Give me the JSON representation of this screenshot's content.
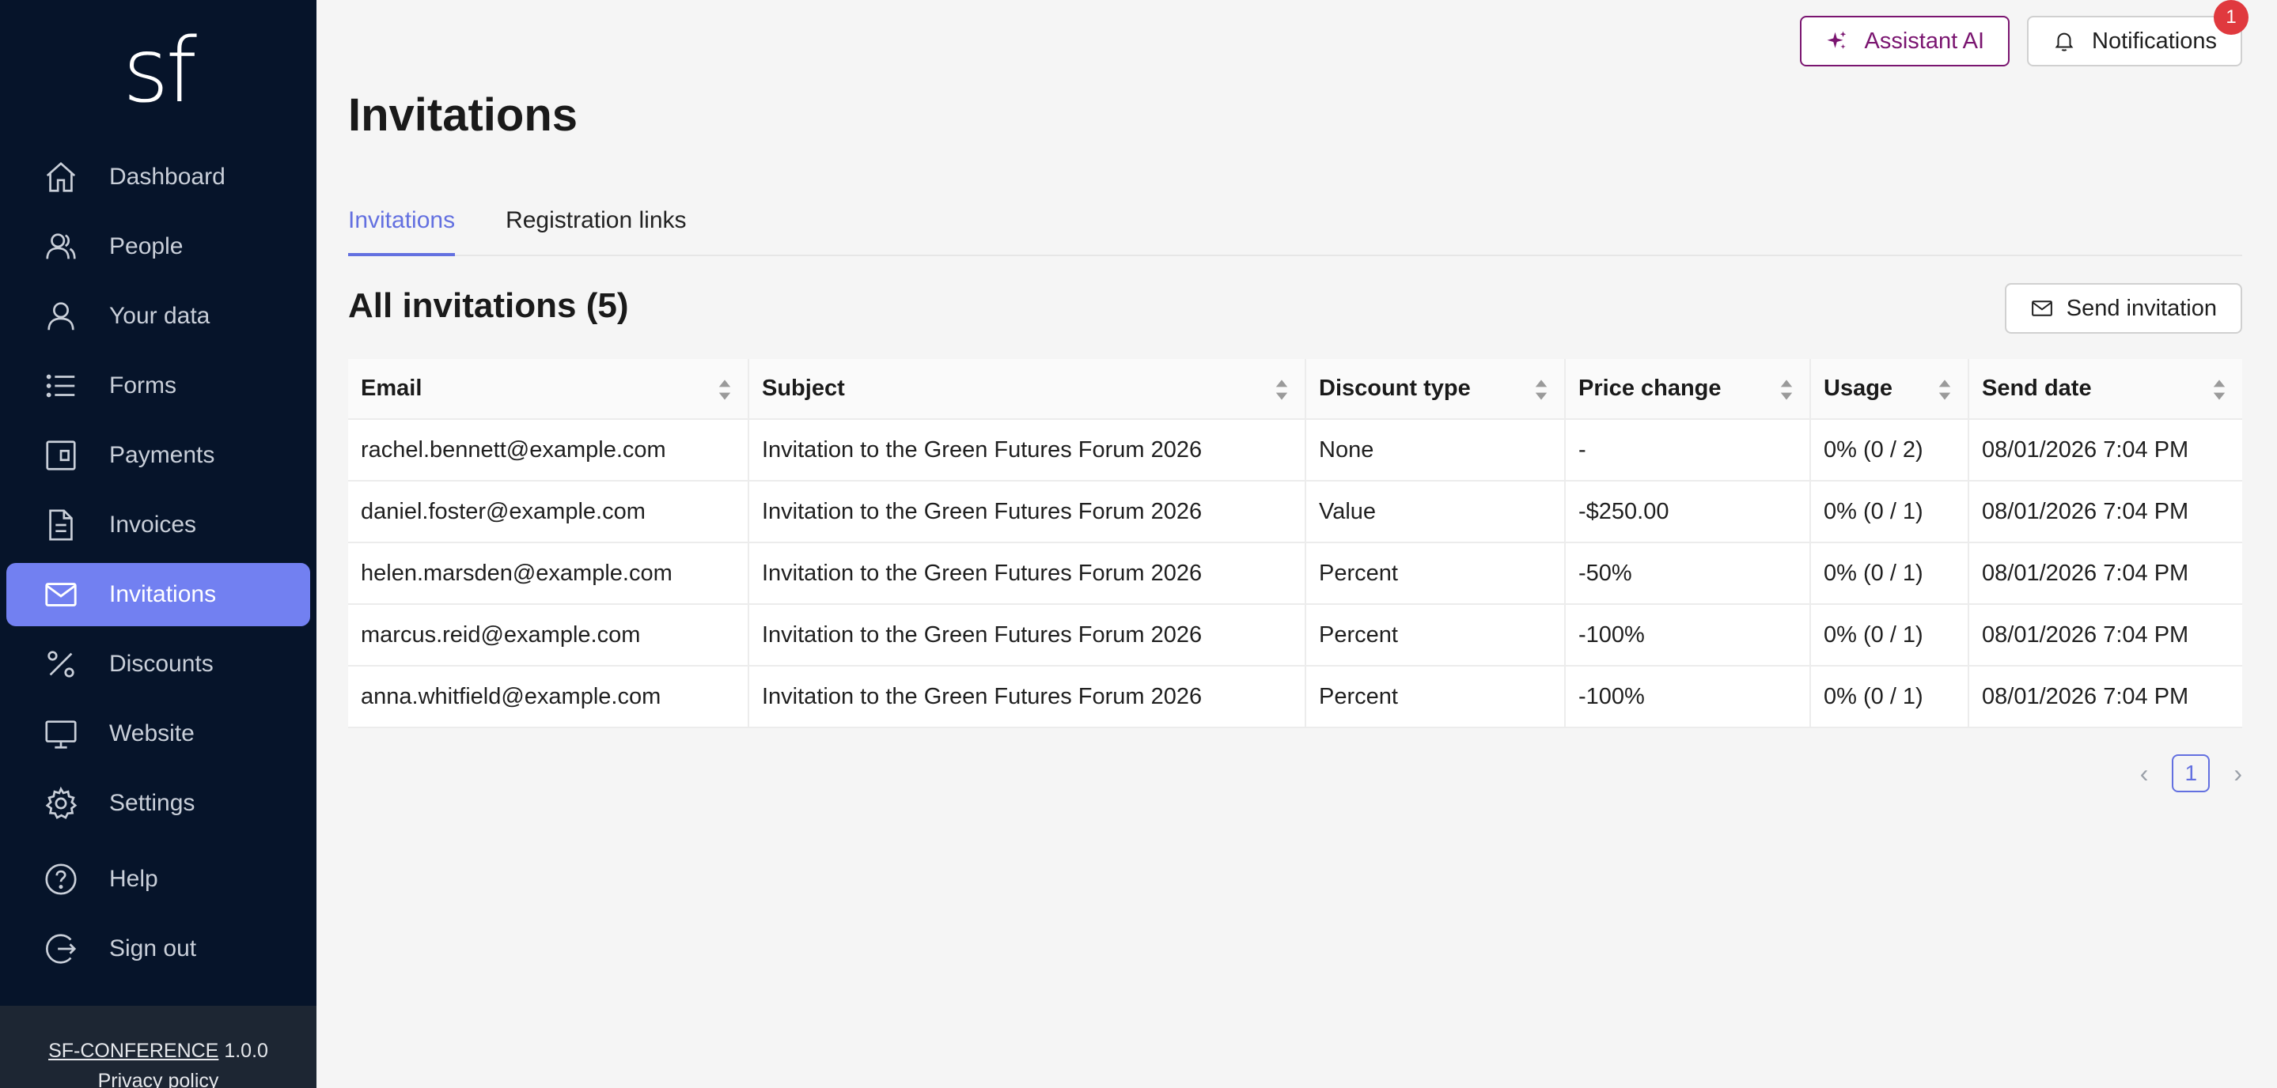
{
  "brand": {
    "logo_text": "sf"
  },
  "sidebar": {
    "items": [
      {
        "label": "Dashboard"
      },
      {
        "label": "People"
      },
      {
        "label": "Your data"
      },
      {
        "label": "Forms"
      },
      {
        "label": "Payments"
      },
      {
        "label": "Invoices"
      },
      {
        "label": "Invitations"
      },
      {
        "label": "Discounts"
      },
      {
        "label": "Website"
      },
      {
        "label": "Settings"
      },
      {
        "label": "Help"
      },
      {
        "label": "Sign out"
      }
    ],
    "footer": {
      "app_name": "SF-CONFERENCE",
      "version": "1.0.0",
      "privacy": "Privacy policy"
    }
  },
  "header": {
    "assistant_label": "Assistant AI",
    "notifications_label": "Notifications",
    "notifications_count": "1"
  },
  "page": {
    "title": "Invitations"
  },
  "tabs": [
    {
      "label": "Invitations"
    },
    {
      "label": "Registration links"
    }
  ],
  "section": {
    "title": "All invitations (5)",
    "send_label": "Send invitation"
  },
  "table": {
    "columns": [
      "Email",
      "Subject",
      "Discount type",
      "Price change",
      "Usage",
      "Send date"
    ],
    "rows": [
      [
        "rachel.bennett@example.com",
        "Invitation to the Green Futures Forum 2026",
        "None",
        "-",
        "0% (0 / 2)",
        "08/01/2026 7:04 PM"
      ],
      [
        "daniel.foster@example.com",
        "Invitation to the Green Futures Forum 2026",
        "Value",
        "-$250.00",
        "0% (0 / 1)",
        "08/01/2026 7:04 PM"
      ],
      [
        "helen.marsden@example.com",
        "Invitation to the Green Futures Forum 2026",
        "Percent",
        "-50%",
        "0% (0 / 1)",
        "08/01/2026 7:04 PM"
      ],
      [
        "marcus.reid@example.com",
        "Invitation to the Green Futures Forum 2026",
        "Percent",
        "-100%",
        "0% (0 / 1)",
        "08/01/2026 7:04 PM"
      ],
      [
        "anna.whitfield@example.com",
        "Invitation to the Green Futures Forum 2026",
        "Percent",
        "-100%",
        "0% (0 / 1)",
        "08/01/2026 7:04 PM"
      ]
    ]
  },
  "pagination": {
    "prev": "‹",
    "current": "1",
    "next": "›"
  },
  "colors": {
    "sidebar_bg": "#06142a",
    "active_item": "#7280f1",
    "accent": "#6370e0",
    "ai_purple": "#7a1570",
    "badge_red": "#e0393e"
  }
}
